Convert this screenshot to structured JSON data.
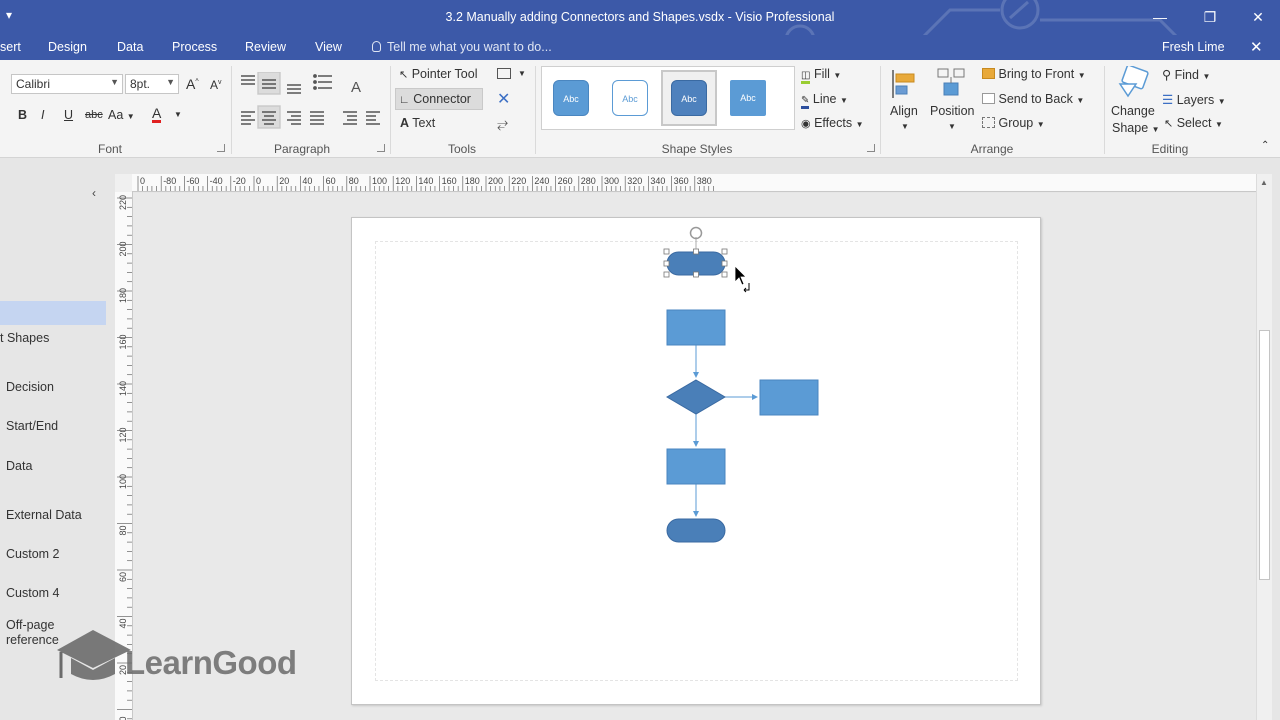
{
  "window": {
    "title": "3.2 Manually adding Connectors and Shapes.vsdx - Visio Professional",
    "qat_icon": "customize-quick-access-icon",
    "minimize": "—",
    "restore": "❐",
    "close": "✕"
  },
  "tabs": [
    {
      "label": "sert"
    },
    {
      "label": "Design"
    },
    {
      "label": "Data"
    },
    {
      "label": "Process"
    },
    {
      "label": "Review"
    },
    {
      "label": "View"
    }
  ],
  "tell_me": "Tell me what you want to do...",
  "theme_name": "Fresh Lime",
  "ribbon": {
    "font": {
      "label": "Font",
      "family": "Calibri",
      "size": "8pt.",
      "grow": "A",
      "shrink": "A",
      "bold": "B",
      "italic": "I",
      "underline": "U",
      "strike": "abc",
      "case": "Aa",
      "color": "A",
      "color_hex": "#e02020"
    },
    "paragraph": {
      "label": "Paragraph",
      "text_dir": "A"
    },
    "tools": {
      "label": "Tools",
      "pointer": "Pointer Tool",
      "connector": "Connector",
      "text": "Text"
    },
    "shape_styles": {
      "label": "Shape Styles",
      "thumb_text": "Abc",
      "fill": "Fill",
      "line": "Line",
      "effects": "Effects"
    },
    "arrange": {
      "label": "Arrange",
      "align": "Align",
      "position": "Position",
      "bring_front": "Bring to Front",
      "send_back": "Send to Back",
      "group": "Group"
    },
    "editing": {
      "label": "Editing",
      "change_shape_1": "Change",
      "change_shape_2": "Shape",
      "find": "Find",
      "layers": "Layers",
      "select": "Select"
    }
  },
  "shapes_pane": {
    "collapse": "‹",
    "items": [
      "t Shapes",
      "Decision",
      "Start/End",
      "Data",
      "External Data",
      "Custom 2",
      "Custom 4",
      "Off-page",
      "reference"
    ]
  },
  "rulers": {
    "h_labels": [
      "0",
      "-80",
      "-60",
      "-40",
      "-20",
      "0",
      "20",
      "40",
      "60",
      "80",
      "100",
      "120",
      "140",
      "160",
      "180",
      "200",
      "220",
      "240",
      "260",
      "280",
      "300",
      "320",
      "340",
      "360",
      "380"
    ],
    "v_labels": [
      "220",
      "200",
      "180",
      "160",
      "140",
      "120",
      "100",
      "80",
      "60",
      "40",
      "20",
      "0"
    ]
  },
  "colors": {
    "titlebar": "#3c59a8",
    "shape_fill": "#5b9bd5",
    "shape_dark": "#4a7fb8",
    "selected_style": "#4e81bd"
  },
  "watermark": "LearnGood"
}
